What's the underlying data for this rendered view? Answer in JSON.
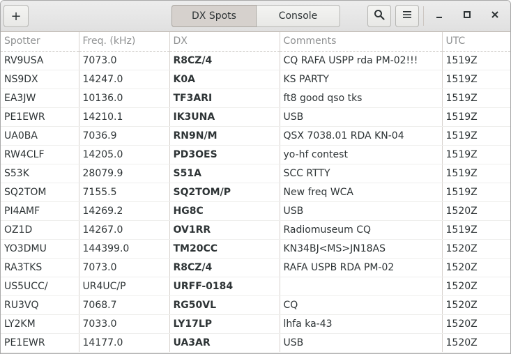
{
  "header": {
    "add_label": "+",
    "tabs": [
      {
        "label": "DX Spots",
        "active": true
      },
      {
        "label": "Console",
        "active": false
      }
    ],
    "search_icon": "search-icon",
    "menu_icon": "hamburger-menu-icon"
  },
  "table": {
    "columns": [
      "Spotter",
      "Freq. (kHz)",
      "DX",
      "Comments",
      "UTC"
    ],
    "rows": [
      [
        "RV9USA",
        "7073.0",
        "R8CZ/4",
        "CQ RAFA USPP rda PM-02!!!",
        "1519Z"
      ],
      [
        "NS9DX",
        "14247.0",
        "K0A",
        "KS PARTY",
        "1519Z"
      ],
      [
        "EA3JW",
        "10136.0",
        "TF3ARI",
        "ft8 good qso tks",
        "1519Z"
      ],
      [
        "PE1EWR",
        "14210.1",
        "IK3UNA",
        "USB",
        "1519Z"
      ],
      [
        "UA0BA",
        "7036.9",
        "RN9N/M",
        "QSX 7038.01 RDA KN-04",
        "1519Z"
      ],
      [
        "RW4CLF",
        "14205.0",
        "PD3OES",
        "yo-hf contest",
        "1519Z"
      ],
      [
        "S53K",
        "28079.9",
        "S51A",
        "SCC RTTY",
        "1519Z"
      ],
      [
        "SQ2TOM",
        "7155.5",
        "SQ2TOM/P",
        "New freq WCA",
        "1519Z"
      ],
      [
        "PI4AMF",
        "14269.2",
        "HG8C",
        "USB",
        "1520Z"
      ],
      [
        "OZ1D",
        "14267.0",
        "OV1RR",
        "Radiomuseum CQ",
        "1519Z"
      ],
      [
        "YO3DMU",
        "144399.0",
        "TM20CC",
        "KN34BJ<MS>JN18AS",
        "1520Z"
      ],
      [
        "RA3TKS",
        "7073.0",
        "R8CZ/4",
        "RAFA USPB RDA PM-02",
        "1520Z"
      ],
      [
        "US5UCC/",
        "UR4UC/P",
        "URFF-0184",
        "",
        "1520Z"
      ],
      [
        "RU3VQ",
        "7068.7",
        "RG50VL",
        "CQ",
        "1520Z"
      ],
      [
        "LY2KM",
        "7033.0",
        "LY17LP",
        "lhfa ka-43",
        "1520Z"
      ],
      [
        "PE1EWR",
        "14177.0",
        "UA3AR",
        "USB",
        "1520Z"
      ]
    ]
  }
}
